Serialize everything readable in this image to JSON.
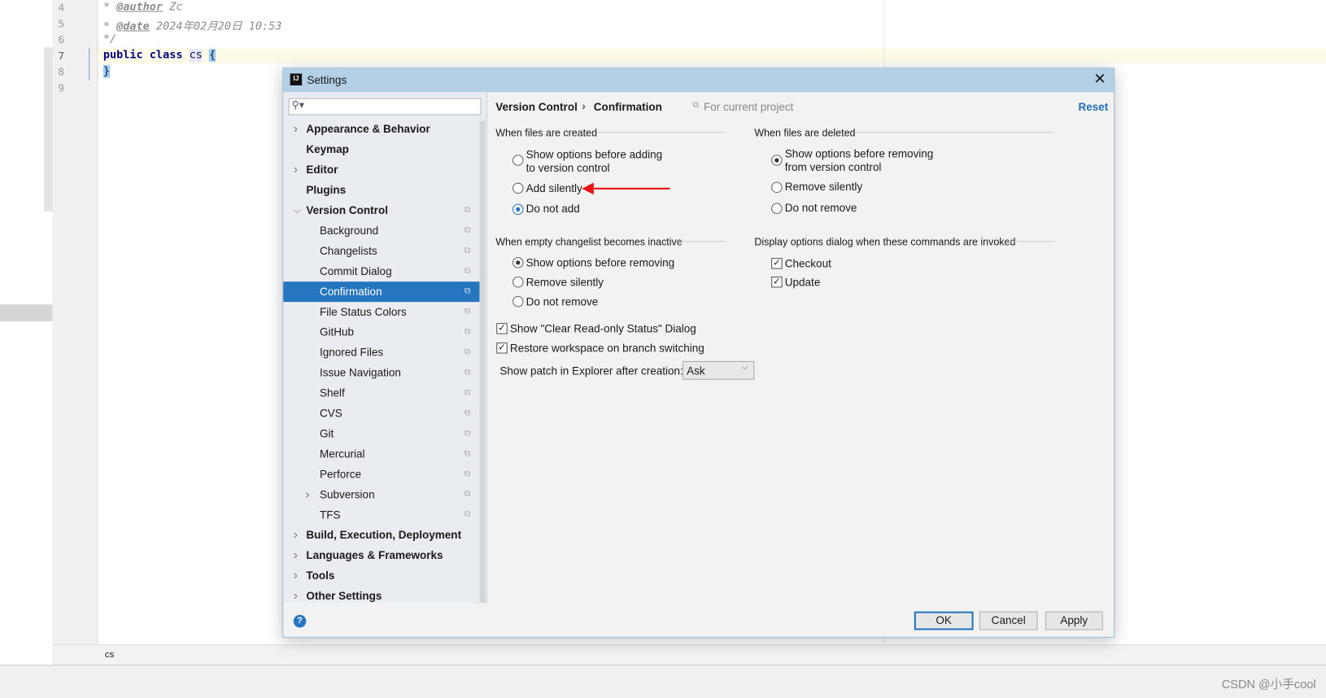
{
  "editor": {
    "lines": [
      {
        "num": "4",
        "text": " * @author Zc"
      },
      {
        "num": "5",
        "text": " * @date 2024年02月20日 10:53"
      },
      {
        "num": "6",
        "text": " */"
      },
      {
        "num": "7",
        "text": "public class cs {"
      },
      {
        "num": "8",
        "text": "}"
      },
      {
        "num": "9",
        "text": ""
      }
    ],
    "author_tag": "@author",
    "author": "Zc",
    "date_tag": "@date",
    "date": "2024年02月20日 10:53",
    "comment_end": "*/",
    "kw_public": "public",
    "kw_class": "class",
    "class_name": "cs",
    "brace_open": "{",
    "brace_close": "}",
    "status_file": "cs"
  },
  "dialog": {
    "title": "Settings",
    "sidebar": {
      "search_placeholder": "",
      "items": [
        {
          "label": "Appearance & Behavior",
          "bold": true,
          "expandable": true
        },
        {
          "label": "Keymap",
          "bold": true
        },
        {
          "label": "Editor",
          "bold": true,
          "expandable": true
        },
        {
          "label": "Plugins",
          "bold": true
        },
        {
          "label": "Version Control",
          "bold": true,
          "expanded": true
        },
        {
          "label": "Background",
          "child": true
        },
        {
          "label": "Changelists",
          "child": true
        },
        {
          "label": "Commit Dialog",
          "child": true
        },
        {
          "label": "Confirmation",
          "child": true,
          "selected": true
        },
        {
          "label": "File Status Colors",
          "child": true
        },
        {
          "label": "GitHub",
          "child": true
        },
        {
          "label": "Ignored Files",
          "child": true
        },
        {
          "label": "Issue Navigation",
          "child": true
        },
        {
          "label": "Shelf",
          "child": true
        },
        {
          "label": "CVS",
          "child": true
        },
        {
          "label": "Git",
          "child": true
        },
        {
          "label": "Mercurial",
          "child": true
        },
        {
          "label": "Perforce",
          "child": true
        },
        {
          "label": "Subversion",
          "child": true,
          "expandable": true
        },
        {
          "label": "TFS",
          "child": true
        },
        {
          "label": "Build, Execution, Deployment",
          "bold": true,
          "expandable": true
        },
        {
          "label": "Languages & Frameworks",
          "bold": true,
          "expandable": true
        },
        {
          "label": "Tools",
          "bold": true,
          "expandable": true
        },
        {
          "label": "Other Settings",
          "bold": true,
          "expandable": true
        }
      ]
    },
    "breadcrumb": {
      "parent": "Version Control",
      "sep": "›",
      "current": "Confirmation",
      "scope": "For current project"
    },
    "reset": "Reset",
    "created": {
      "title": "When files are created",
      "opt1a": "Show options before adding",
      "opt1b": "to version control",
      "opt2": "Add silently",
      "opt3": "Do not add",
      "selected": 3
    },
    "deleted": {
      "title": "When files are deleted",
      "opt1a": "Show options before removing",
      "opt1b": "from version control",
      "opt2": "Remove silently",
      "opt3": "Do not remove",
      "selected": 1
    },
    "changelist": {
      "title": "When empty changelist becomes inactive",
      "opt1": "Show options before removing",
      "opt2": "Remove silently",
      "opt3": "Do not remove",
      "selected": 1
    },
    "commands": {
      "title": "Display options dialog when these commands are invoked",
      "checkout": "Checkout",
      "update": "Update",
      "checkout_checked": true,
      "update_checked": true
    },
    "clear_readonly": "Show \"Clear Read-only Status\" Dialog",
    "restore_workspace": "Restore workspace on branch switching",
    "patch_label": "Show patch in Explorer after creation:",
    "patch_value": "Ask",
    "buttons": {
      "ok": "OK",
      "cancel": "Cancel",
      "apply": "Apply"
    },
    "help": "?",
    "annotation_arrow_color": "#e81010",
    "accent": "#2675bf"
  },
  "watermark": "CSDN @小手cool"
}
